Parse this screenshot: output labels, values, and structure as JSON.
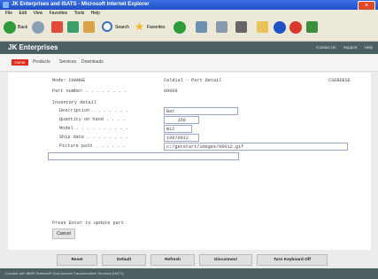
{
  "window": {
    "title": "JK Enterprises and ISATS - Microsoft Internet Explorer"
  },
  "menu": [
    "File",
    "Edit",
    "View",
    "Favorites",
    "Tools",
    "Help"
  ],
  "toolbar": {
    "back": "Back",
    "search": "Search",
    "favorites": "Favorites"
  },
  "site": {
    "brand": "JK Enterprises",
    "links": [
      "Contact Us",
      "Support",
      "Help"
    ]
  },
  "nav": {
    "home": "Home",
    "items": [
      "Products",
      "Services",
      "Downloads"
    ]
  },
  "screen": {
    "header_left": "Mode: CHANGE",
    "header_center": "Celdial - Part Detail",
    "header_right": "CSEBDESE",
    "part_number_label": "Part number . . . . . . . .",
    "part_number_value": "00008",
    "section_label": "Inventory detail",
    "rows": [
      {
        "label": "Description . . . . . . .",
        "value": "Bar"
      },
      {
        "label": "Quantity on hand . . . .",
        "value": "    150"
      },
      {
        "label": "Model . . . . . . . . . .",
        "value": "m12"
      },
      {
        "label": "Ship date . . . . . . . .",
        "value": "19970812"
      },
      {
        "label": "Picture path . . . . . .",
        "value": "c:/getstart/images/00012.gif"
      }
    ],
    "hint": "Press Enter to update part",
    "cancel": "Cancel"
  },
  "commands": [
    "Reset",
    "Default",
    "Refresh",
    "Disconnect",
    "Turn Keyboard Off"
  ],
  "status": "Created with IBM® Rational® Host Access Transformation Services (HATS)"
}
